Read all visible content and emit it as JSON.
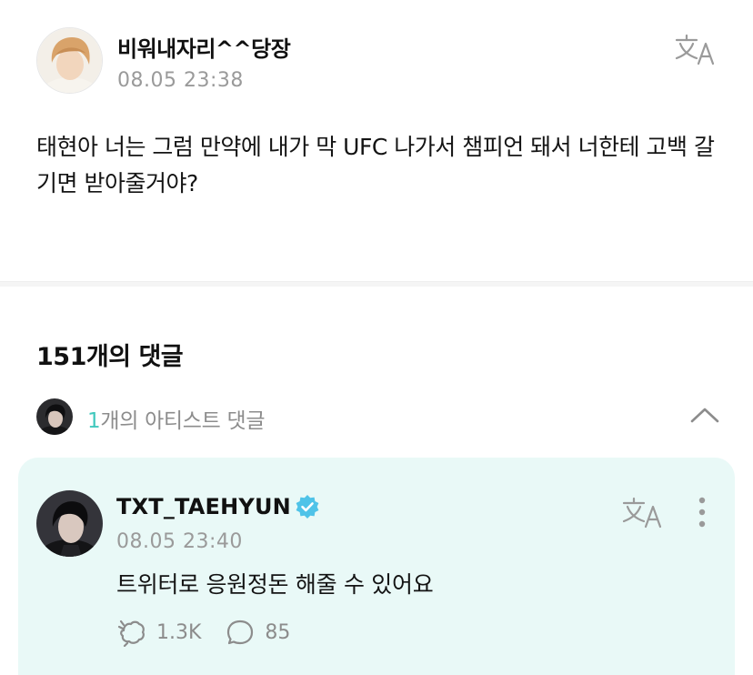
{
  "post": {
    "author": "비워내자리^^당장",
    "timestamp": "08.05 23:38",
    "body": "태현아 너는 그럼 만약에 내가 막 UFC 나가서 챔피언 돼서 너한테 고백 갈기면 받아줄거야?",
    "translate_icon": "translate-icon"
  },
  "comments": {
    "count_label": "151개의 댓글",
    "artist_summary": {
      "count": "1",
      "label": "개의 아티스트 댓글",
      "collapse_icon": "chevron-up-icon"
    },
    "artist_comment": {
      "author": "TXT_TAEHYUN",
      "verified_icon": "verified-badge-icon",
      "timestamp": "08.05 23:40",
      "text": "트위터로 응원정돈 해줄 수 있어요",
      "likes": "1.3K",
      "replies": "85",
      "like_icon": "like-icon",
      "reply_icon": "comment-bubble-icon",
      "more_icon": "more-vertical-icon"
    }
  },
  "colors": {
    "accent": "#41c8bd",
    "card_background": "#e9f9f7",
    "verified": "#4fc3e8",
    "muted_text": "#9a9a9a"
  }
}
